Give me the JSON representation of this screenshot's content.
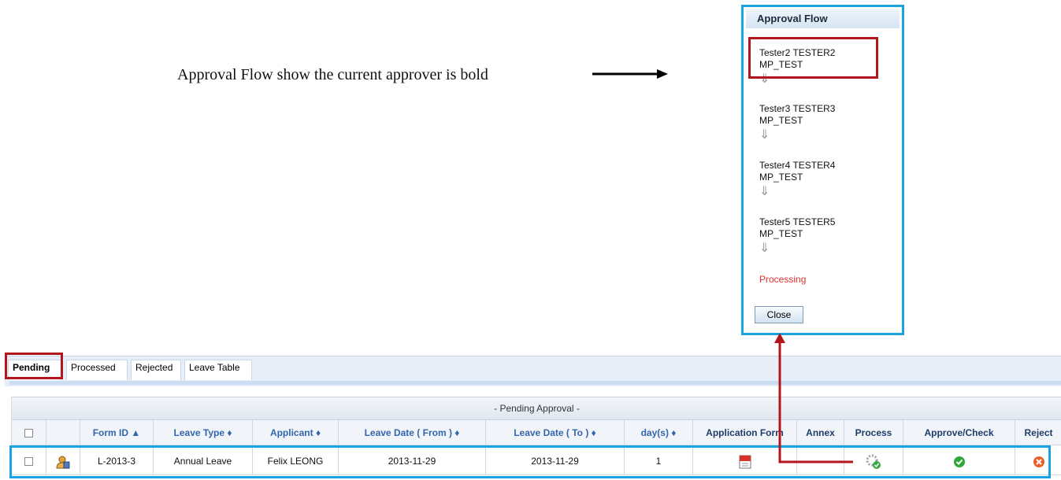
{
  "annotation": {
    "text": "Approval Flow show the current approver is bold"
  },
  "popup": {
    "title": "Approval Flow",
    "steps": [
      {
        "name": "Tester2 TESTER2",
        "dept": "MP_TEST"
      },
      {
        "name": "Tester3 TESTER3",
        "dept": "MP_TEST"
      },
      {
        "name": "Tester4 TESTER4",
        "dept": "MP_TEST"
      },
      {
        "name": "Tester5 TESTER5",
        "dept": "MP_TEST"
      }
    ],
    "status": "Processing",
    "close_label": "Close",
    "arrow": "⇓"
  },
  "tabs": [
    "Pending",
    "Processed",
    "Rejected",
    "Leave Table"
  ],
  "grid": {
    "title": "- Pending Approval -",
    "columns": {
      "form_id": "Form ID ▲",
      "leave_type": "Leave Type ♦",
      "applicant": "Applicant ♦",
      "date_from": "Leave Date ( From ) ♦",
      "date_to": "Leave Date ( To ) ♦",
      "days": "day(s) ♦",
      "app_form": "Application Form",
      "annex": "Annex",
      "process": "Process",
      "approve": "Approve/Check",
      "reject": "Reject"
    },
    "row": {
      "form_id": "L-2013-3",
      "leave_type": "Annual Leave",
      "applicant": "Felix LEONG",
      "date_from": "2013-11-29",
      "date_to": "2013-11-29",
      "days": "1"
    }
  },
  "colors": {
    "highlight_red": "#b3151c",
    "highlight_blue": "#1aa3e0",
    "link_blue": "#3466ad",
    "processing": "#e03030"
  }
}
